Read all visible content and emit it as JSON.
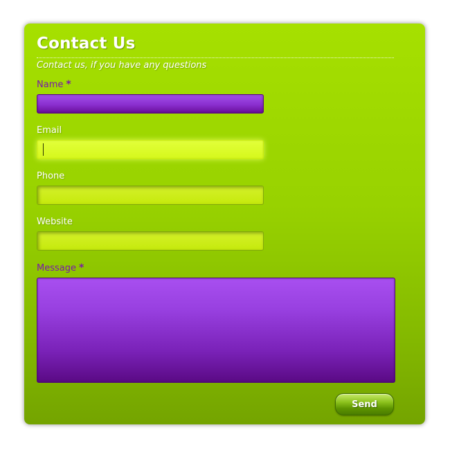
{
  "form": {
    "title": "Contact Us",
    "subtitle": "Contact us, if you have any questions",
    "required_marker": "*",
    "fields": {
      "name": {
        "label": "Name",
        "required": true,
        "value": ""
      },
      "email": {
        "label": "Email",
        "required": false,
        "value": "",
        "focused": true
      },
      "phone": {
        "label": "Phone",
        "required": false,
        "value": ""
      },
      "website": {
        "label": "Website",
        "required": false,
        "value": ""
      },
      "message": {
        "label": "Message",
        "required": true,
        "value": ""
      }
    },
    "send_label": "Send"
  },
  "colors": {
    "panel_top": "#a6e000",
    "panel_bottom": "#74a400",
    "required_purple": "#7a1aa8",
    "field_lime": "#c6ea0c",
    "field_purple": "#8a2fcf"
  }
}
